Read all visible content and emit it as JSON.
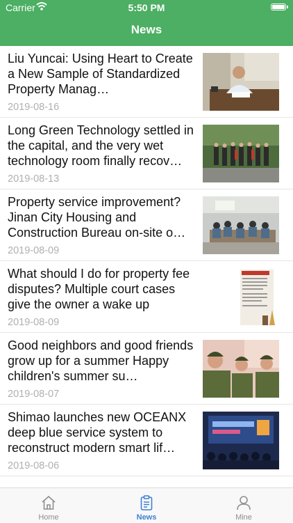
{
  "status_bar": {
    "carrier": "Carrier",
    "time": "5:50 PM",
    "icons": [
      "wifi-icon",
      "battery-icon"
    ]
  },
  "nav": {
    "title": "News",
    "color": "#4caf63"
  },
  "articles": [
    {
      "title": "Liu Yuncai: Using Heart to Create a New Sample of Standardized Property Manag…",
      "date": "2019-08-16"
    },
    {
      "title": "Long Green Technology settled in the capital, and the very wet technology room finally recov…",
      "date": "2019-08-13"
    },
    {
      "title": "Property service improvement? Jinan City Housing and Construction Bureau on-site o…",
      "date": "2019-08-09"
    },
    {
      "title": "What should I do for property fee disputes? Multiple court cases give the owner a wake up",
      "date": "2019-08-09"
    },
    {
      "title": "Good neighbors and good friends grow up for a summer Happy children's summer su…",
      "date": "2019-08-07"
    },
    {
      "title": "Shimao launches new OCEANX deep blue service system to reconstruct modern smart lif…",
      "date": "2019-08-06"
    }
  ],
  "tabbar": {
    "tabs": [
      {
        "label": "Home",
        "icon": "home-icon",
        "active": false
      },
      {
        "label": "News",
        "icon": "clipboard-icon",
        "active": true
      },
      {
        "label": "Mine",
        "icon": "person-icon",
        "active": false
      }
    ],
    "active_color": "#3d7fd6",
    "inactive_color": "#8e8e8e"
  }
}
